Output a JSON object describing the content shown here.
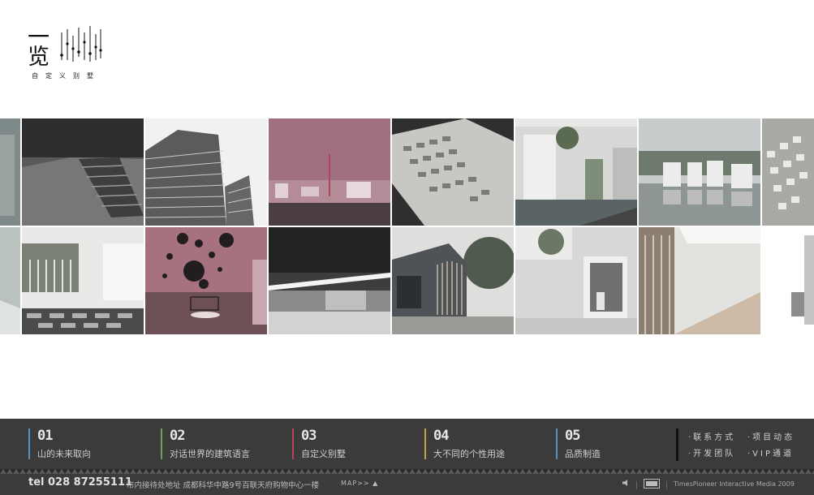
{
  "logo": {
    "char_top": "一",
    "char_bottom": "览",
    "subtitle": "自定义别墅"
  },
  "gallery": {
    "rows": [
      [
        "building-detail",
        "stairway-concrete",
        "tower-block",
        "pink-landscape",
        "site-model",
        "courtyard-pool",
        "lakeside-villas",
        "aerial-housing"
      ],
      [
        "glass-facade",
        "bamboo-courtyard",
        "pink-bubble-room",
        "pavilion-interior",
        "wooden-house",
        "window-wall",
        "attic-interior",
        "white-facade"
      ]
    ]
  },
  "nav": {
    "items": [
      {
        "num": "01",
        "label": "山的未来取向",
        "accent": "#5b8fbf"
      },
      {
        "num": "02",
        "label": "对话世界的建筑语言",
        "accent": "#6fa05a"
      },
      {
        "num": "03",
        "label": "自定义别墅",
        "accent": "#b8445a"
      },
      {
        "num": "04",
        "label": "大不同的个性用途",
        "accent": "#c9a046"
      },
      {
        "num": "05",
        "label": "品质制造",
        "accent": "#5b8fbf"
      }
    ],
    "quick_links": [
      "·联系方式",
      "·项目动态",
      "·开发团队",
      "·VIP通道"
    ]
  },
  "footer": {
    "tel": "tel 028  87255111",
    "address": "市内接待处地址 成都科华中路9号百联天府购物中心一楼",
    "map": "MAP>>",
    "credit": "TimesPioneer Interactive Media 2009"
  },
  "colors": {
    "bar": "#3b3b3b",
    "pink_tint": "#a17080"
  }
}
